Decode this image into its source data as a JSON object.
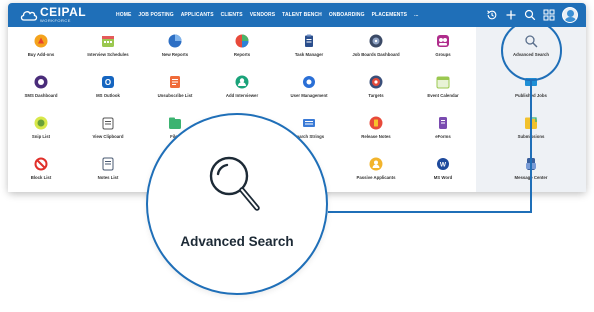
{
  "app": {
    "logo_text": "CEIPAL",
    "logo_sub": "WORKFORCE"
  },
  "nav": {
    "items": [
      "HOME",
      "JOB POSTING",
      "APPLICANTS",
      "CLIENTS",
      "VENDORS",
      "TALENT BENCH",
      "ONBOARDING",
      "PLACEMENTS",
      "..."
    ],
    "active": "HOME"
  },
  "top_icons": [
    "history-icon",
    "plus-icon",
    "search-icon",
    "apps-grid-icon",
    "user-avatar"
  ],
  "tiles": {
    "row1": [
      "Buy Add-ons",
      "Interview Schedules",
      "New Reports",
      "Reports",
      "Task Manager",
      "Job Boards Dashboard",
      "Groups",
      "Advanced Search"
    ],
    "row2": [
      "SMS Dashboard",
      "MS Outlook",
      "Unsubscribe List",
      "Add Interviewer",
      "User Management",
      "Targets",
      "Event Calendar",
      "Published Jobs"
    ],
    "row3": [
      "Snip List",
      "View Clipboard",
      "Files",
      "",
      "Search Strings",
      "Release Notes",
      "eForms",
      "Submissions"
    ],
    "row4": [
      "Block List",
      "Notes List",
      "",
      "",
      "",
      "Passive Applicants",
      "MS Word",
      "Message Center"
    ]
  },
  "callout": {
    "label": "Advanced Search"
  },
  "colors": {
    "brand": "#1f6fb8",
    "accent_gray": "#eef1f5"
  }
}
